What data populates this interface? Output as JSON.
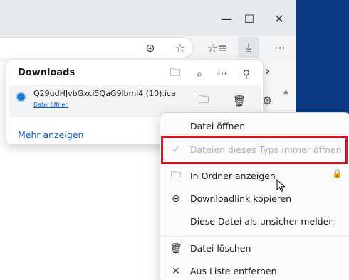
{
  "window": {
    "minimize_glyph": "—",
    "maximize_glyph": "☐",
    "close_glyph": "✕"
  },
  "toolbar": {
    "zoom_glyph": "⊕",
    "favorite_glyph": "☆",
    "favorites_list_glyph": "☆≡",
    "download_glyph": "⤓",
    "more_glyph": "···"
  },
  "sidebar": {
    "chevron_glyph": "›",
    "settings_glyph": "⚙",
    "scroll_glyph": "▲"
  },
  "downloads": {
    "title": "Downloads",
    "header_icons": {
      "folder": "🗀",
      "search": "⌕",
      "more": "···",
      "pin": "⚲"
    },
    "items": [
      {
        "filename": "Q29udHJvbGxci5QaG9lbml4 (10).ica",
        "action_link": "Datei öffnen",
        "folder_glyph": "🗀",
        "delete_glyph": "🗑"
      }
    ],
    "show_more": "Mehr anzeigen"
  },
  "context_menu": {
    "items": [
      {
        "label": "Datei öffnen",
        "icon": "",
        "disabled": false
      },
      {
        "label": "Dateien dieses Typs immer öffnen",
        "icon": "✓",
        "disabled": true
      },
      {
        "label": "In Ordner anzeigen",
        "icon": "🗀",
        "disabled": false
      },
      {
        "label": "Downloadlink kopieren",
        "icon": "⊖",
        "disabled": false
      },
      {
        "label": "Diese Datei als unsicher melden",
        "icon": "",
        "disabled": false
      },
      {
        "label": "Datei löschen",
        "icon": "🗑",
        "disabled": false
      },
      {
        "label": "Aus Liste entfernen",
        "icon": "✕",
        "disabled": false
      }
    ],
    "lock_glyph": "🔒"
  },
  "colors": {
    "accent": "#0a5fb4",
    "highlight_box": "#d9121f",
    "side_panel": "#0b3a83"
  }
}
